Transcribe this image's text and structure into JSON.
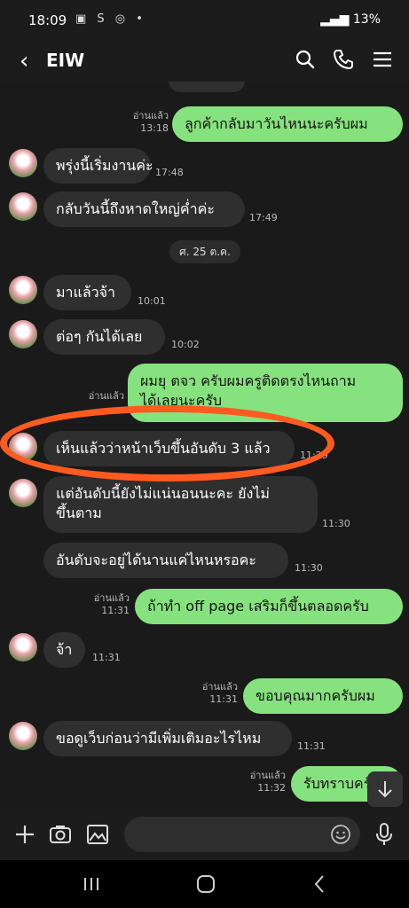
{
  "status": {
    "time": "18:09",
    "battery": "13%",
    "left_icons": "▣ S ◎ •"
  },
  "header": {
    "back_glyph": "‹",
    "title": "EIW"
  },
  "date_separator": "ศ. 25 ต.ค.",
  "read_label": "อ่านแล้ว",
  "messages": [
    {
      "dir": "out",
      "text": "ลูกค้ากลับมาวันไหนนะครับผม",
      "time": "13:18"
    },
    {
      "dir": "in",
      "text": "พรุ่งนี้เริ่มงานค่ะ",
      "time": "17:48"
    },
    {
      "dir": "in",
      "text": "กลับวันนี้ถึงหาดใหญ่ค่ำค่ะ",
      "time": "17:49"
    },
    {
      "dir": "in",
      "text": "มาแล้วจ้า",
      "time": "10:01"
    },
    {
      "dir": "in",
      "text": "ต่อๆ กันได้เลย",
      "time": "10:02"
    },
    {
      "dir": "out",
      "line1": "ผมยุ ตจว ครับผมครูติดตรงไหนถาม",
      "line2": "ได้เลยนะครับ"
    },
    {
      "dir": "in",
      "text": "เห็นแล้วว่าหน้าเว็บขึ้นอันดับ 3 แล้ว",
      "time": "11:29"
    },
    {
      "dir": "in",
      "line1": "แต่อันดับนี้ยังไม่แน่นอนนะคะ ยังไม่",
      "line2": "ขึ้นตาม",
      "time": "11:30"
    },
    {
      "dir": "in",
      "text": "อันดับจะอยู่ได้นานแค่ไหนหรอคะ",
      "time": "11:30"
    },
    {
      "dir": "out",
      "text": "ถ้าทำ off page เสริมก็ขึ้นตลอดครับ",
      "time": "11:31"
    },
    {
      "dir": "in",
      "text": "จ้า",
      "time": "11:31"
    },
    {
      "dir": "out",
      "text": "ขอบคุณมากครับผม",
      "time": "11:31"
    },
    {
      "dir": "in",
      "text": "ขอดูเว็บก่อนว่ามีเพิ่มเติมอะไรไหม",
      "time": "11:31"
    },
    {
      "dir": "out",
      "text": "รับทราบครับ",
      "time": "11:32"
    }
  ],
  "colors": {
    "outgoing": "#86e27e",
    "incoming": "#2f2f2f",
    "highlight": "#ff5a1f",
    "background": "#1a1a1a"
  },
  "icons": [
    "back-icon",
    "search-icon",
    "phone-icon",
    "menu-icon",
    "plus-icon",
    "camera-icon",
    "gallery-icon",
    "emoji-icon",
    "mic-icon",
    "scroll-down-icon",
    "recents-icon",
    "home-icon",
    "nav-back-icon"
  ]
}
